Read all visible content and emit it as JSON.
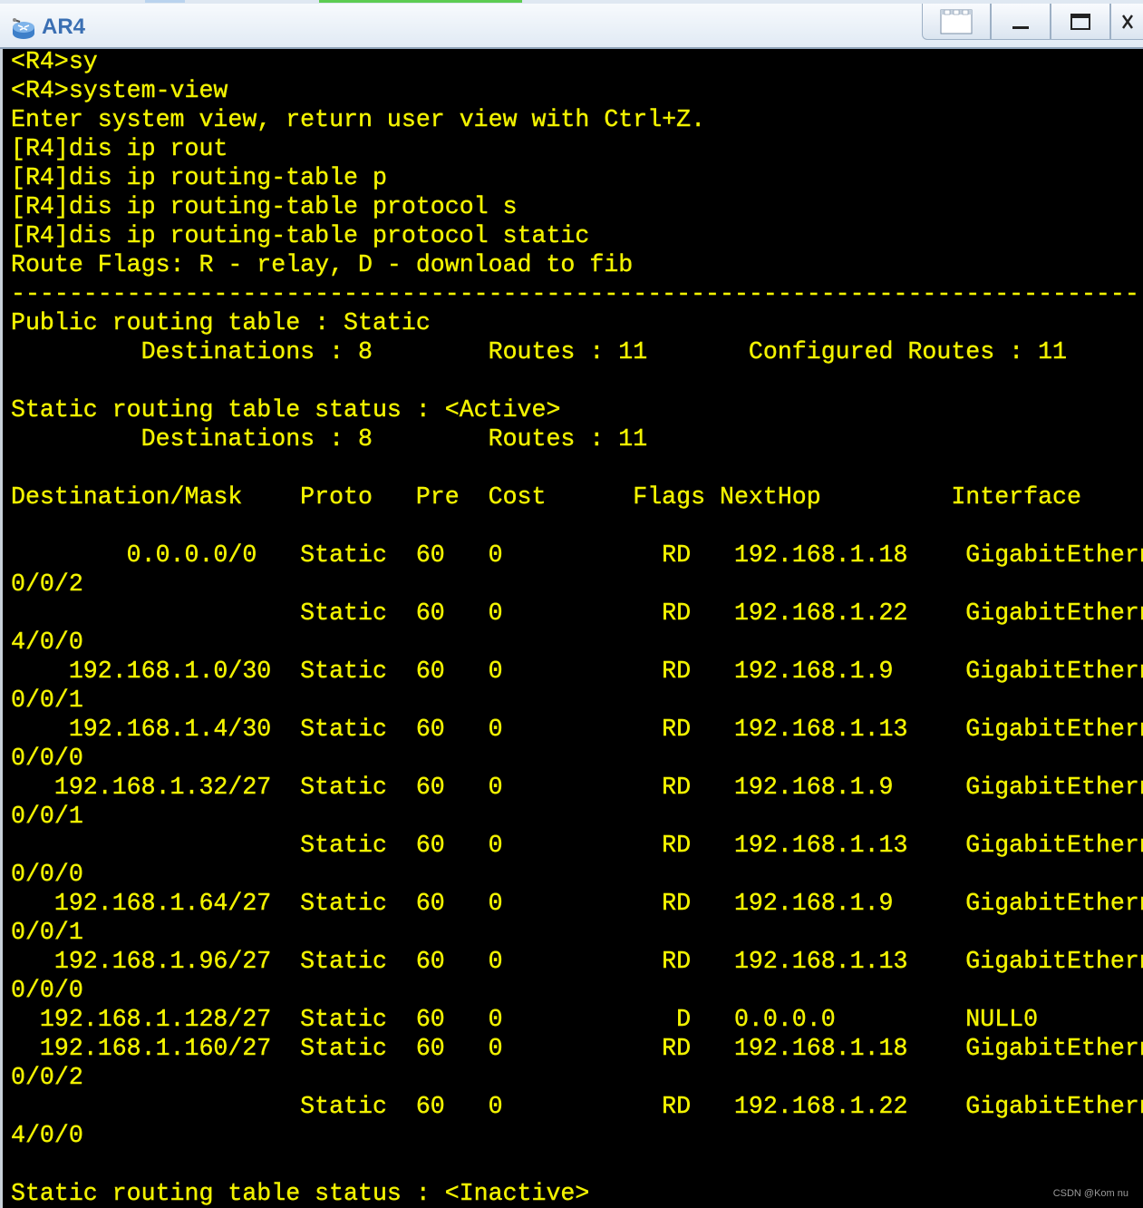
{
  "window": {
    "title": "AR4",
    "icon": "router-icon",
    "buttons": [
      "tile-icon",
      "minimize-icon",
      "maximize-icon",
      "close-icon"
    ]
  },
  "terminal": {
    "text_color": "#f2f200",
    "background": "#000000",
    "lines": [
      "<R4>sy",
      "<R4>system-view",
      "Enter system view, return user view with Ctrl+Z.",
      "[R4]dis ip rout",
      "[R4]dis ip routing-table p",
      "[R4]dis ip routing-table protocol s",
      "[R4]dis ip routing-table protocol static",
      "Route Flags: R - relay, D - download to fib",
      "------------------------------------------------------------------------------",
      "Public routing table : Static",
      "         Destinations : 8        Routes : 11       Configured Routes : 11",
      "",
      "Static routing table status : <Active>",
      "         Destinations : 8        Routes : 11",
      "",
      "Destination/Mask    Proto   Pre  Cost      Flags NextHop         Interface",
      "",
      "        0.0.0.0/0   Static  60   0           RD   192.168.1.18    GigabitEthern",
      "0/0/2",
      "                    Static  60   0           RD   192.168.1.22    GigabitEthern",
      "4/0/0",
      "    192.168.1.0/30  Static  60   0           RD   192.168.1.9     GigabitEthern",
      "0/0/1",
      "    192.168.1.4/30  Static  60   0           RD   192.168.1.13    GigabitEthern",
      "0/0/0",
      "   192.168.1.32/27  Static  60   0           RD   192.168.1.9     GigabitEthern",
      "0/0/1",
      "                    Static  60   0           RD   192.168.1.13    GigabitEthern",
      "0/0/0",
      "   192.168.1.64/27  Static  60   0           RD   192.168.1.9     GigabitEthern",
      "0/0/1",
      "   192.168.1.96/27  Static  60   0           RD   192.168.1.13    GigabitEthern",
      "0/0/0",
      "  192.168.1.128/27  Static  60   0            D   0.0.0.0         NULL0",
      "  192.168.1.160/27  Static  60   0           RD   192.168.1.18    GigabitEthern",
      "0/0/2",
      "                    Static  60   0           RD   192.168.1.22    GigabitEthern",
      "4/0/0",
      "",
      "Static routing table status : <Inactive>"
    ]
  },
  "watermark": "CSDN @Kom nu"
}
